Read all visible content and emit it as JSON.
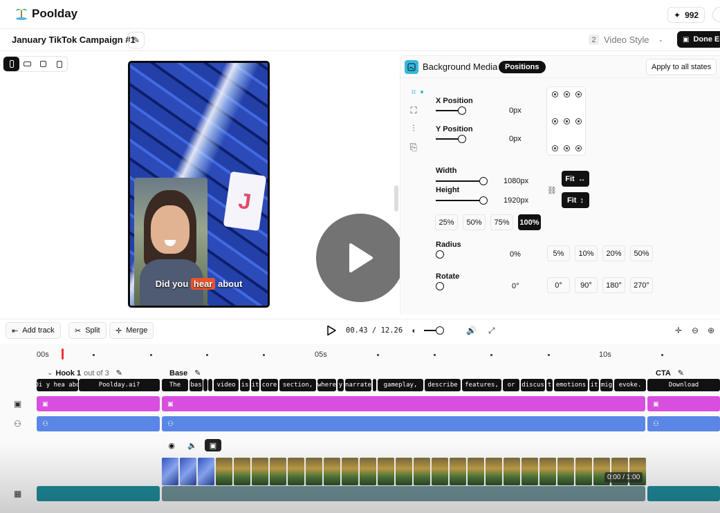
{
  "app": {
    "name": "Poolday",
    "credits": "992"
  },
  "project": {
    "title": "January TikTok Campaign #1",
    "step_number": "2",
    "step_label": "Video Style",
    "done_label": "Done Ed"
  },
  "panel": {
    "title": "Background Media",
    "tab": "Positions",
    "apply_label": "Apply to all states",
    "x_label": "X Position",
    "x_value": "0px",
    "y_label": "Y Position",
    "y_value": "0px",
    "width_label": "Width",
    "width_value": "1080px",
    "height_label": "Height",
    "height_value": "1920px",
    "fit_label": "Fit",
    "scale_chips": [
      "25%",
      "50%",
      "75%",
      "100%"
    ],
    "scale_active": "100%",
    "radius_label": "Radius",
    "radius_value": "0%",
    "radius_chips": [
      "5%",
      "10%",
      "20%",
      "50%"
    ],
    "rotate_label": "Rotate",
    "rotate_value": "0°",
    "rotate_chips": [
      "0°",
      "90°",
      "180°",
      "270°"
    ]
  },
  "preview": {
    "caption_before": "Did you",
    "caption_highlight": "hear",
    "caption_after": "about",
    "card_letter": "J"
  },
  "toolbar": {
    "add_track": "Add track",
    "split": "Split",
    "merge": "Merge",
    "time": "00.43 / 12.26"
  },
  "timeline": {
    "ruler": [
      "00s",
      "05s",
      "10s"
    ],
    "segments": [
      {
        "name": "Hook 1",
        "sub": "out of 3"
      },
      {
        "name": "Base",
        "sub": ""
      },
      {
        "name": "CTA",
        "sub": ""
      }
    ],
    "words": [
      "Di y hea abo",
      "Poolday.ai?",
      "The",
      "bas",
      "",
      "",
      "video",
      "is",
      "it",
      "core",
      "section,",
      "where",
      "y",
      "narrate",
      "",
      "gameplay,",
      "describe",
      "features,",
      "or",
      "discus",
      "t",
      "emotions",
      "it",
      "mig",
      "evoke.",
      "Download"
    ],
    "duration": "0:00 / 1:00"
  }
}
